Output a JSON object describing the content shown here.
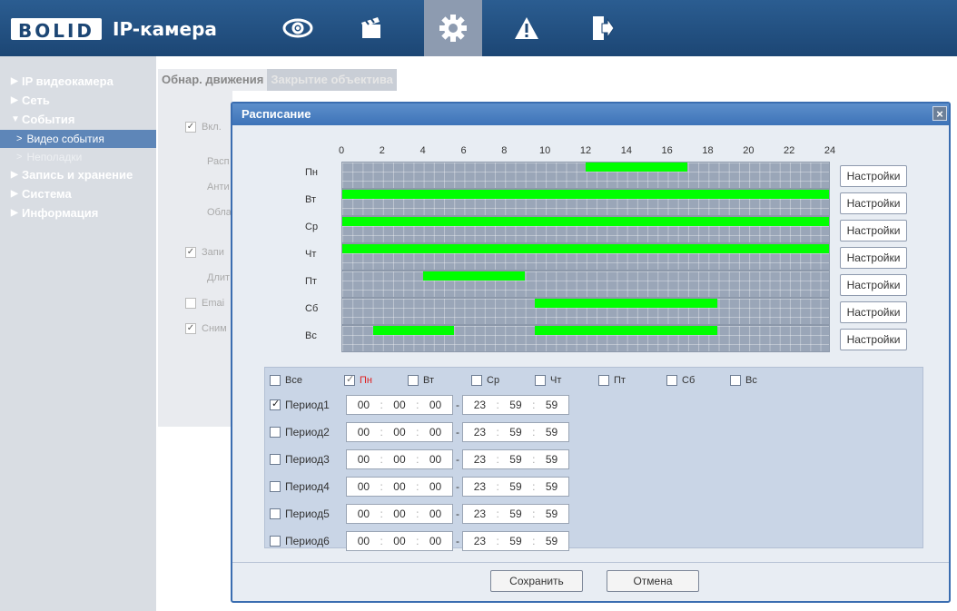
{
  "header": {
    "brand": "BOLID",
    "product": "IP-камера",
    "nav_icons": [
      "eye-icon",
      "clapperboard-icon",
      "gear-icon",
      "warning-icon",
      "exit-icon"
    ],
    "active_index": 2
  },
  "sidebar": {
    "items": [
      {
        "label": "IP видеокамера"
      },
      {
        "label": "Сеть"
      },
      {
        "label": "События"
      },
      {
        "label": "Видео события"
      },
      {
        "label": "Неполадки"
      },
      {
        "label": "Запись и хранение"
      },
      {
        "label": "Система"
      },
      {
        "label": "Информация"
      }
    ]
  },
  "tabs": [
    "Обнар. движения",
    "Закрытие объектива"
  ],
  "background_rows": [
    "Вкл.",
    "Расп",
    "Анти",
    "Обла",
    "Запи",
    "Длит",
    "Emai",
    "Сним"
  ],
  "dialog": {
    "title": "Расписание",
    "close": "×",
    "hours": [
      "0",
      "2",
      "4",
      "6",
      "8",
      "10",
      "12",
      "14",
      "16",
      "18",
      "20",
      "22",
      "24"
    ],
    "days": [
      {
        "label": "Пн",
        "button": "Настройки",
        "segments": [
          {
            "start": 12,
            "end": 17
          }
        ]
      },
      {
        "label": "Вт",
        "button": "Настройки",
        "segments": [
          {
            "start": 0,
            "end": 24
          }
        ]
      },
      {
        "label": "Ср",
        "button": "Настройки",
        "segments": [
          {
            "start": 0,
            "end": 24
          }
        ]
      },
      {
        "label": "Чт",
        "button": "Настройки",
        "segments": [
          {
            "start": 0,
            "end": 24
          }
        ]
      },
      {
        "label": "Пт",
        "button": "Настройки",
        "segments": [
          {
            "start": 4,
            "end": 9
          }
        ]
      },
      {
        "label": "Сб",
        "button": "Настройки",
        "segments": [
          {
            "start": 9.5,
            "end": 18.5
          }
        ]
      },
      {
        "label": "Вс",
        "button": "Настройки",
        "segments": [
          {
            "start": 1.5,
            "end": 5.5
          },
          {
            "start": 9.5,
            "end": 18.5
          }
        ]
      }
    ],
    "day_checks": [
      {
        "label": "Все",
        "checked": false
      },
      {
        "label": "Пн",
        "checked": true,
        "highlight": true
      },
      {
        "label": "Вт",
        "checked": false
      },
      {
        "label": "Ср",
        "checked": false
      },
      {
        "label": "Чт",
        "checked": false
      },
      {
        "label": "Пт",
        "checked": false
      },
      {
        "label": "Сб",
        "checked": false
      },
      {
        "label": "Вс",
        "checked": false
      }
    ],
    "periods": [
      {
        "label": "Период1",
        "checked": true,
        "start": [
          "00",
          "00",
          "00"
        ],
        "end": [
          "23",
          "59",
          "59"
        ]
      },
      {
        "label": "Период2",
        "checked": false,
        "start": [
          "00",
          "00",
          "00"
        ],
        "end": [
          "23",
          "59",
          "59"
        ]
      },
      {
        "label": "Период3",
        "checked": false,
        "start": [
          "00",
          "00",
          "00"
        ],
        "end": [
          "23",
          "59",
          "59"
        ]
      },
      {
        "label": "Период4",
        "checked": false,
        "start": [
          "00",
          "00",
          "00"
        ],
        "end": [
          "23",
          "59",
          "59"
        ]
      },
      {
        "label": "Период5",
        "checked": false,
        "start": [
          "00",
          "00",
          "00"
        ],
        "end": [
          "23",
          "59",
          "59"
        ]
      },
      {
        "label": "Период6",
        "checked": false,
        "start": [
          "00",
          "00",
          "00"
        ],
        "end": [
          "23",
          "59",
          "59"
        ]
      }
    ],
    "save_label": "Сохранить",
    "cancel_label": "Отмена"
  },
  "colors": {
    "header": "#1c4674",
    "active_segment": "#00ff00",
    "grid": "#9aa6b8",
    "dialog_border": "#3a6db0"
  }
}
